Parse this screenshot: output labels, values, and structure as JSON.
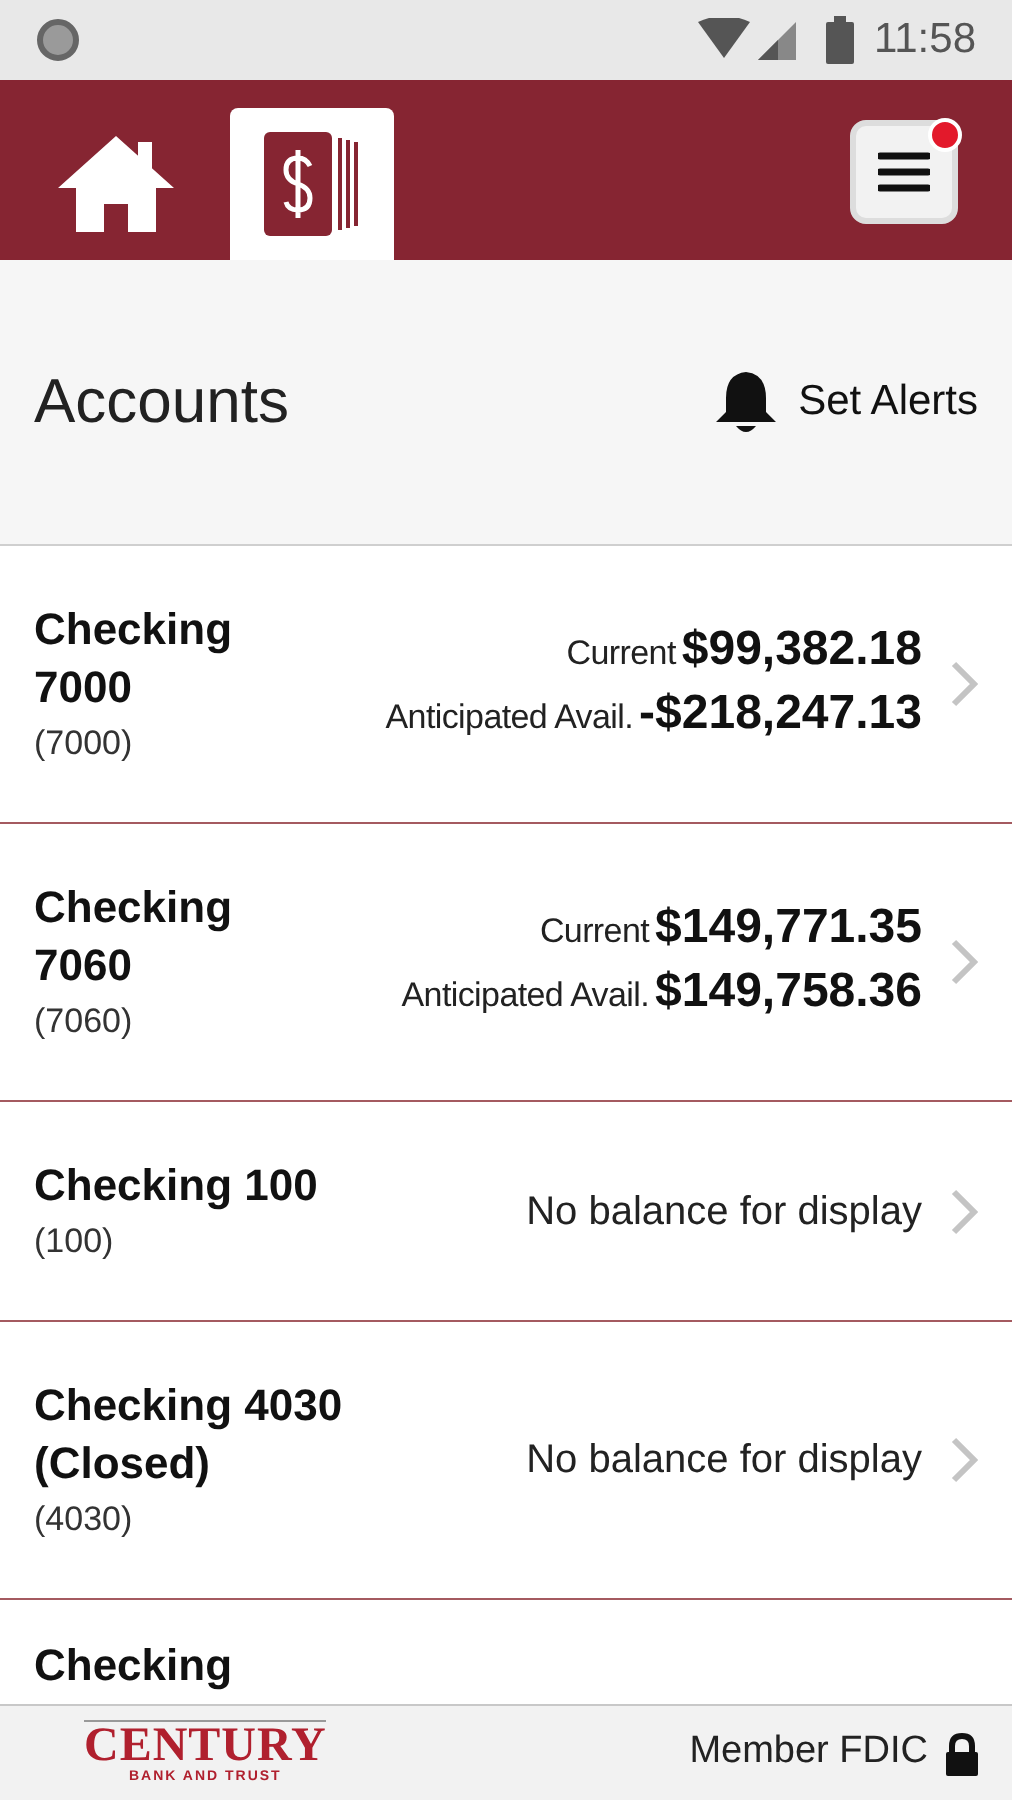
{
  "status_bar": {
    "time": "11:58"
  },
  "nav_tabs": [
    {
      "kind": "home",
      "selected": false
    },
    {
      "kind": "accounts",
      "selected": true
    }
  ],
  "menu_button": {
    "notification": true
  },
  "page": {
    "title": "Accounts",
    "alerts_button": "Set Alerts"
  },
  "accounts": [
    {
      "kind": "balances",
      "name": "Checking 7000",
      "number": "(7000)",
      "balances": [
        {
          "label": "Current",
          "amount": "$99,382.18"
        },
        {
          "label": "Anticipated Avail.",
          "amount": "-$218,247.13"
        }
      ]
    },
    {
      "kind": "balances",
      "name": "Checking 7060",
      "number": "(7060)",
      "balances": [
        {
          "label": "Current",
          "amount": "$149,771.35"
        },
        {
          "label": "Anticipated Avail.",
          "amount": "$149,758.36"
        }
      ]
    },
    {
      "kind": "no_balance",
      "name": "Checking 100",
      "number": "(100)",
      "message": "No balance for display"
    },
    {
      "kind": "no_balance",
      "name": "Checking 4030 (Closed)",
      "number": "(4030)",
      "message": "No balance for display"
    },
    {
      "kind": "partial",
      "name": "Checking"
    }
  ],
  "footer": {
    "logo_name": "CENTURY",
    "logo_tagline": "BANK AND TRUST",
    "fdic": "Member FDIC"
  }
}
